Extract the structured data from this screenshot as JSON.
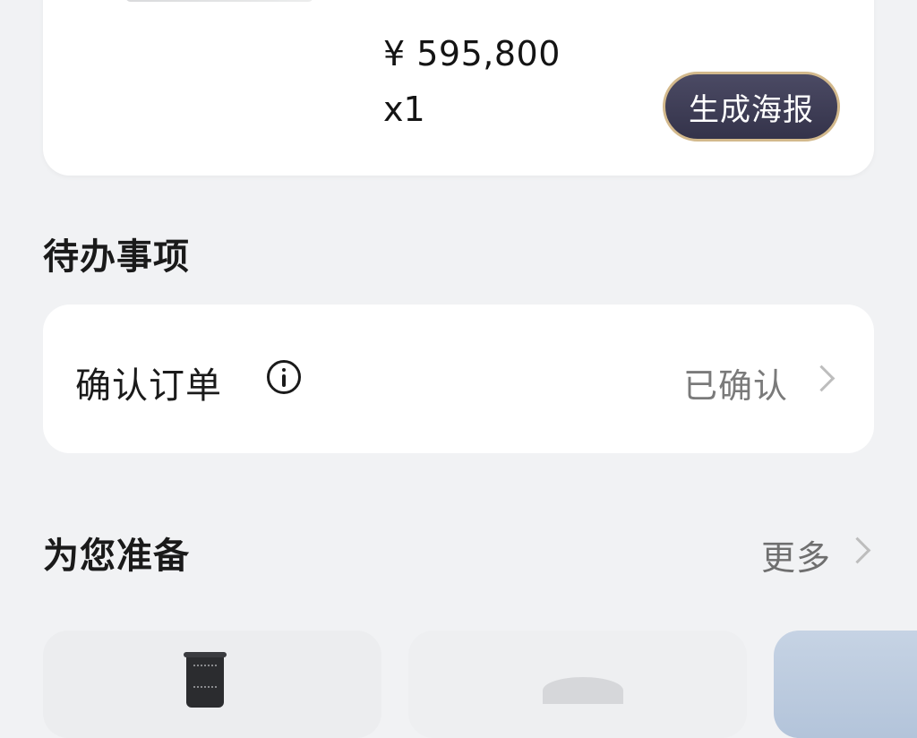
{
  "order": {
    "price": "¥ 595,800",
    "quantity": "x1",
    "poster_button": "生成海报"
  },
  "todo": {
    "title": "待办事项",
    "item_label": "确认订单",
    "item_status": "已确认"
  },
  "prepared": {
    "title": "为您准备",
    "more_label": "更多"
  },
  "colors": {
    "background": "#f1f2f4",
    "card": "#ffffff",
    "poster_button_bg": "#3d3c55",
    "poster_button_border": "#d3b98c",
    "muted_text": "#7a7a7a"
  }
}
